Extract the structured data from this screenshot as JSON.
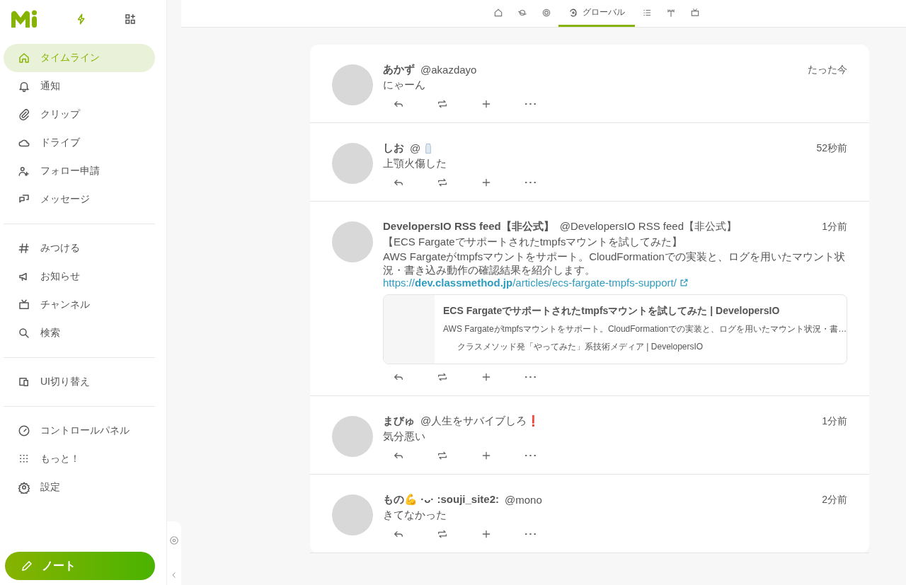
{
  "sidebar": {
    "nav_groups": [
      [
        {
          "label": "タイムライン",
          "selected": true
        },
        {
          "label": "通知",
          "selected": false
        },
        {
          "label": "クリップ",
          "selected": false
        },
        {
          "label": "ドライブ",
          "selected": false
        },
        {
          "label": "フォロー申請",
          "selected": false
        },
        {
          "label": "メッセージ",
          "selected": false
        }
      ],
      [
        {
          "label": "みつける",
          "selected": false
        },
        {
          "label": "お知らせ",
          "selected": false
        },
        {
          "label": "チャンネル",
          "selected": false
        },
        {
          "label": "検索",
          "selected": false
        }
      ],
      [
        {
          "label": "UI切り替え",
          "selected": false
        }
      ],
      [
        {
          "label": "コントロールパネル",
          "selected": false
        },
        {
          "label": "もっと！",
          "selected": false
        },
        {
          "label": "設定",
          "selected": false
        }
      ]
    ],
    "post_button": "ノート"
  },
  "timeline_tabs": [
    {
      "selected": false
    },
    {
      "selected": false
    },
    {
      "selected": false
    },
    {
      "label": "グローバル",
      "selected": true
    },
    {
      "selected": false
    },
    {
      "selected": false
    },
    {
      "selected": false
    }
  ],
  "notes": [
    {
      "name": "あかず",
      "handle": "@akazdayo",
      "time": "たった今",
      "text": [
        "にゃーん"
      ]
    },
    {
      "name": "しお",
      "handle": "@",
      "handle_emoji": true,
      "time": "52秒前",
      "text": [
        "上顎火傷した"
      ]
    },
    {
      "name": "DevelopersIO RSS feed【非公式】",
      "handle": "@DevelopersIO RSS feed【非公式】",
      "time": "1分前",
      "text": [
        "【ECS Fargateでサポートされたtmpfsマウントを試してみた】",
        "AWS Fargateがtmpfsマウントをサポート。CloudFormationでの実装と、ログを用いたマウント状況・書き込み動作の確認結果を紹介します。"
      ],
      "link": "https://**dev.classmethod.jp**/articles/ecs-fargate-tmpfs-support/",
      "preview": {
        "title": "ECS Fargateでサポートされたtmpfsマウントを試してみた | DevelopersIO",
        "description": "AWS Fargateがtmpfsマウントをサポート。CloudFormationでの実装と、ログを用いたマウント状況・書…",
        "site": "クラスメソッド発「やってみた」系技術メディア | DevelopersIO"
      }
    },
    {
      "name": "まびゅ",
      "handle": "@人生をサバイブしろ❗",
      "time": "1分前",
      "text": [
        "気分悪い"
      ]
    },
    {
      "name": "もの💪 ·ᴗ· :souji_site2:",
      "handle": "@mono",
      "time": "2分前",
      "text": [
        "きてなかった"
      ]
    }
  ]
}
